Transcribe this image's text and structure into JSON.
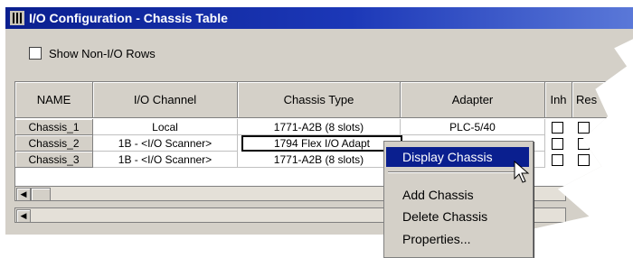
{
  "window": {
    "title": "I/O Configuration - Chassis Table"
  },
  "options": {
    "show_non_io_label": "Show Non-I/O Rows",
    "show_non_io_checked": false
  },
  "table": {
    "headers": [
      "NAME",
      "I/O Channel",
      "Chassis Type",
      "Adapter",
      "Inh",
      "Res"
    ],
    "rows": [
      {
        "name": "Chassis_1",
        "channel": "Local",
        "type": "1771-A2B (8 slots)",
        "adapter": "PLC-5/40",
        "inh": false,
        "res": false
      },
      {
        "name": "Chassis_2",
        "channel": "1B - <I/O Scanner>",
        "type": "1794 Flex I/O Adapt",
        "adapter": "",
        "inh": false,
        "res": false
      },
      {
        "name": "Chassis_3",
        "channel": "1B - <I/O Scanner>",
        "type": "1771-A2B (8 slots)",
        "adapter": "",
        "inh": false,
        "res": false
      }
    ]
  },
  "context_menu": {
    "items": [
      "Display Chassis",
      "Add Chassis",
      "Delete Chassis",
      "Properties..."
    ],
    "highlighted": "Display Chassis"
  },
  "icons": {
    "title_icon": "chassis-icon",
    "scroll_left": "scroll-left-arrow-icon",
    "cursor": "mouse-pointer-icon"
  },
  "colors": {
    "titlebar": "#0a1f8f",
    "highlight": "#0a1f8f",
    "face": "#d4d0c8"
  }
}
